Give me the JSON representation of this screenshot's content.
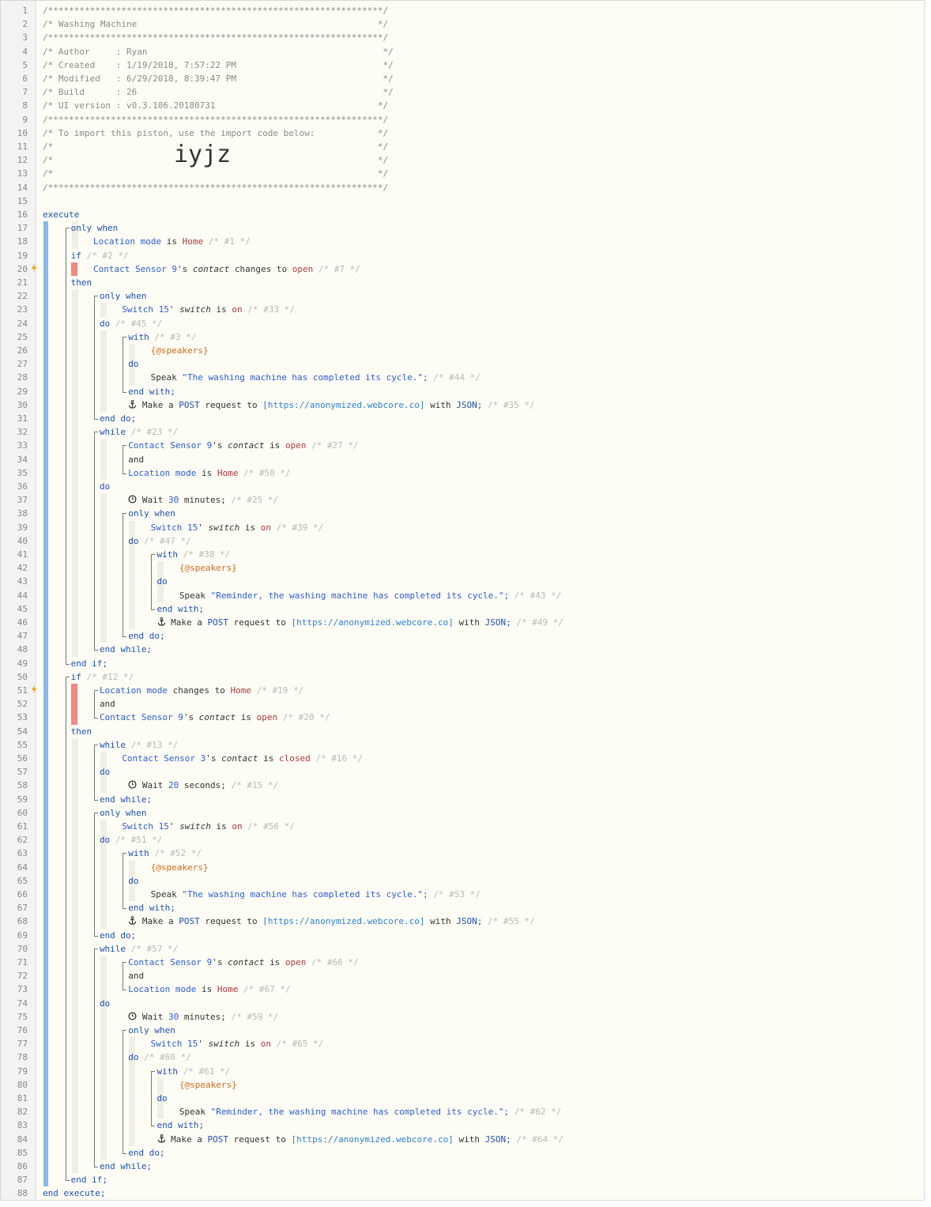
{
  "header": {
    "border": "/****************************************************************/",
    "title_line": "/* Washing Machine                                              */",
    "author_line": "/* Author     : Ryan                                             */",
    "created_line": "/* Created    : 1/19/2018, 7:57:22 PM                            */",
    "modified_line": "/* Modified   : 6/29/2018, 8:39:47 PM                            */",
    "build_line": "/* Build      : 26                                               */",
    "ui_line": "/* UI version : v0.3.106.20180731                               */",
    "import_line": "/* To import this piston, use the import code below:            */",
    "blank_line": "/*                                                              */",
    "import_code": "iyjz"
  },
  "code": {
    "execute": "execute",
    "end_execute": "end execute;",
    "only_when": "only when",
    "if": "if",
    "then": "then",
    "and": "and",
    "do": "do",
    "with": "with",
    "end_with": "end with;",
    "end_do": "end do;",
    "while": "while",
    "end_while": "end while;",
    "end_if": "end if;",
    "location_mode": "Location mode",
    "is": "is",
    "home": "Home",
    "contact_sensor_9": "Contact Sensor 9",
    "contact_sensor_3": "Contact Sensor 3",
    "switch_15": "Switch 15",
    "apos_s": "'s",
    "apos": "'",
    "contact": "contact",
    "switch": "switch",
    "changes_to": "changes to",
    "open": "open",
    "on": "on",
    "closed": "closed",
    "speakers": "{@speakers}",
    "speak": "Speak",
    "msg1": "\"The washing machine has completed its cycle.\";",
    "msg2": "\"Reminder, the washing machine has completed its cycle.\";",
    "make_a": "Make a",
    "post": "POST",
    "request_to": "request to",
    "url": "[https://anonymized.webcore.co]",
    "with_json_with": "with",
    "json": "JSON;",
    "wait": "Wait",
    "minutes": "minutes;",
    "seconds": "seconds;",
    "n30": "30",
    "n20": "20",
    "comments": {
      "c1": "/* #1 */",
      "c2": "/* #2 */",
      "c7": "/* #7 */",
      "c33": "/* #33 */",
      "c45": "/* #45 */",
      "c3": "/* #3 */",
      "c44": "/* #44 */",
      "c35": "/* #35 */",
      "c23": "/* #23 */",
      "c27": "/* #27 */",
      "c50": "/* #50 */",
      "c25": "/* #25 */",
      "c39": "/* #39 */",
      "c47": "/* #47 */",
      "c38": "/* #38 */",
      "c43": "/* #43 */",
      "c49": "/* #49 */",
      "c12": "/* #12 */",
      "c19": "/* #19 */",
      "c20": "/* #20 */",
      "c13": "/* #13 */",
      "c16": "/* #16 */",
      "c15": "/* #15 */",
      "c56": "/* #56 */",
      "c51": "/* #51 */",
      "c52": "/* #52 */",
      "c53": "/* #53 */",
      "c55": "/* #55 */",
      "c57": "/* #57 */",
      "c66": "/* #66 */",
      "c67": "/* #67 */",
      "c59": "/* #59 */",
      "c65": "/* #65 */",
      "c60": "/* #60 */",
      "c61": "/* #61 */",
      "c62": "/* #62 */",
      "c64": "/* #64 */"
    }
  },
  "icons": {
    "anchor": "anchor-icon",
    "clock": "clock-icon",
    "lightning": "lightning-icon"
  },
  "colors": {
    "rail_blue": "#87b9ea",
    "rail_red": "#ef8b80",
    "keyword": "#1f4fb4",
    "value": "#b03a3a"
  }
}
